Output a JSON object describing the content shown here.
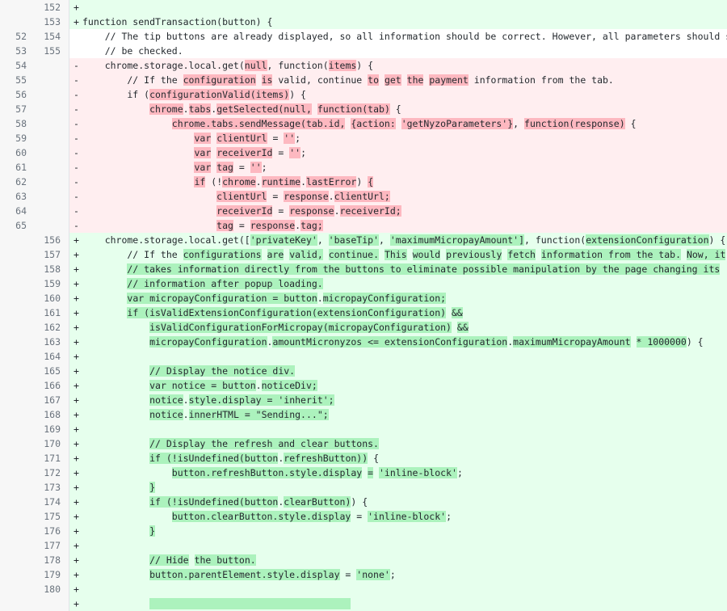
{
  "view": {
    "type": "unified-diff",
    "colors": {
      "addition_bg": "#e6ffed",
      "deletion_bg": "#ffeef0",
      "addition_word_bg": "#acf2bd",
      "deletion_word_bg": "#fdb8c0",
      "gutter_bg": "#f7f7f7",
      "gutter_border": "#e1e4e8",
      "text": "#24292e",
      "lineno_text": "#6a737d",
      "context_bg": "#ffffff"
    }
  },
  "rows": [
    {
      "old": "",
      "new": "152",
      "marker": "+",
      "type": "add",
      "segments": [
        {
          "t": "",
          "h": false
        }
      ]
    },
    {
      "old": "",
      "new": "153",
      "marker": "+",
      "type": "add",
      "segments": [
        {
          "t": "function sendTransaction(button) {",
          "h": false
        }
      ]
    },
    {
      "old": "52",
      "new": "154",
      "marker": "",
      "type": "ctx",
      "segments": [
        {
          "t": "    // The tip buttons are already displayed, so all information should be correct. However, all parameters should still",
          "h": false
        }
      ]
    },
    {
      "old": "53",
      "new": "155",
      "marker": "",
      "type": "ctx",
      "segments": [
        {
          "t": "    // be checked.",
          "h": false
        }
      ]
    },
    {
      "old": "54",
      "new": "",
      "marker": "-",
      "type": "del",
      "segments": [
        {
          "t": "    chrome.storage.local.get(",
          "h": false
        },
        {
          "t": "null",
          "h": true
        },
        {
          "t": ", function(",
          "h": false
        },
        {
          "t": "items",
          "h": true
        },
        {
          "t": ") {",
          "h": false
        }
      ]
    },
    {
      "old": "55",
      "new": "",
      "marker": "-",
      "type": "del",
      "segments": [
        {
          "t": "        // If the ",
          "h": false
        },
        {
          "t": "configuration",
          "h": true
        },
        {
          "t": " ",
          "h": false
        },
        {
          "t": "is",
          "h": true
        },
        {
          "t": " valid, continue ",
          "h": false
        },
        {
          "t": "to",
          "h": true
        },
        {
          "t": " ",
          "h": false
        },
        {
          "t": "get",
          "h": true
        },
        {
          "t": " ",
          "h": false
        },
        {
          "t": "the",
          "h": true
        },
        {
          "t": " ",
          "h": false
        },
        {
          "t": "payment",
          "h": true
        },
        {
          "t": " information from the tab.",
          "h": false
        }
      ]
    },
    {
      "old": "56",
      "new": "",
      "marker": "-",
      "type": "del",
      "segments": [
        {
          "t": "        if (",
          "h": false
        },
        {
          "t": "configurationValid(items)",
          "h": true
        },
        {
          "t": ") {",
          "h": false
        }
      ]
    },
    {
      "old": "57",
      "new": "",
      "marker": "-",
      "type": "del",
      "segments": [
        {
          "t": "            ",
          "h": false
        },
        {
          "t": "chrome",
          "h": true
        },
        {
          "t": ".",
          "h": false
        },
        {
          "t": "tabs",
          "h": true
        },
        {
          "t": ".",
          "h": false
        },
        {
          "t": "getSelected(null,",
          "h": true
        },
        {
          "t": " ",
          "h": false
        },
        {
          "t": "function(tab)",
          "h": true
        },
        {
          "t": " {",
          "h": false
        }
      ]
    },
    {
      "old": "58",
      "new": "",
      "marker": "-",
      "type": "del",
      "segments": [
        {
          "t": "                ",
          "h": false
        },
        {
          "t": "chrome.tabs.sendMessage(tab.id,",
          "h": true
        },
        {
          "t": " ",
          "h": false
        },
        {
          "t": "{action:",
          "h": true
        },
        {
          "t": " ",
          "h": false
        },
        {
          "t": "'getNyzoParameters'}",
          "h": true
        },
        {
          "t": ", ",
          "h": false
        },
        {
          "t": "function(response)",
          "h": true
        },
        {
          "t": " {",
          "h": false
        }
      ]
    },
    {
      "old": "59",
      "new": "",
      "marker": "-",
      "type": "del",
      "segments": [
        {
          "t": "                    ",
          "h": false
        },
        {
          "t": "var",
          "h": true
        },
        {
          "t": " ",
          "h": false
        },
        {
          "t": "clientUrl",
          "h": true
        },
        {
          "t": " = ",
          "h": false
        },
        {
          "t": "''",
          "h": true
        },
        {
          "t": ";",
          "h": false
        }
      ]
    },
    {
      "old": "60",
      "new": "",
      "marker": "-",
      "type": "del",
      "segments": [
        {
          "t": "                    ",
          "h": false
        },
        {
          "t": "var",
          "h": true
        },
        {
          "t": " ",
          "h": false
        },
        {
          "t": "receiverId",
          "h": true
        },
        {
          "t": " = ",
          "h": false
        },
        {
          "t": "''",
          "h": true
        },
        {
          "t": ";",
          "h": false
        }
      ]
    },
    {
      "old": "61",
      "new": "",
      "marker": "-",
      "type": "del",
      "segments": [
        {
          "t": "                    ",
          "h": false
        },
        {
          "t": "var",
          "h": true
        },
        {
          "t": " ",
          "h": false
        },
        {
          "t": "tag",
          "h": true
        },
        {
          "t": " = ",
          "h": false
        },
        {
          "t": "''",
          "h": true
        },
        {
          "t": ";",
          "h": false
        }
      ]
    },
    {
      "old": "62",
      "new": "",
      "marker": "-",
      "type": "del",
      "segments": [
        {
          "t": "                    ",
          "h": false
        },
        {
          "t": "if",
          "h": true
        },
        {
          "t": " (!",
          "h": false
        },
        {
          "t": "chrome",
          "h": true
        },
        {
          "t": ".",
          "h": false
        },
        {
          "t": "runtime",
          "h": true
        },
        {
          "t": ".",
          "h": false
        },
        {
          "t": "lastError",
          "h": true
        },
        {
          "t": ") ",
          "h": false
        },
        {
          "t": "{",
          "h": true
        }
      ]
    },
    {
      "old": "63",
      "new": "",
      "marker": "-",
      "type": "del",
      "segments": [
        {
          "t": "                        ",
          "h": false
        },
        {
          "t": "clientUrl",
          "h": true
        },
        {
          "t": " = ",
          "h": false
        },
        {
          "t": "response",
          "h": true
        },
        {
          "t": ".",
          "h": false
        },
        {
          "t": "clientUrl;",
          "h": true
        }
      ]
    },
    {
      "old": "64",
      "new": "",
      "marker": "-",
      "type": "del",
      "segments": [
        {
          "t": "                        ",
          "h": false
        },
        {
          "t": "receiverId",
          "h": true
        },
        {
          "t": " = ",
          "h": false
        },
        {
          "t": "response",
          "h": true
        },
        {
          "t": ".",
          "h": false
        },
        {
          "t": "receiverId;",
          "h": true
        }
      ]
    },
    {
      "old": "65",
      "new": "",
      "marker": "-",
      "type": "del",
      "segments": [
        {
          "t": "                        ",
          "h": false
        },
        {
          "t": "tag",
          "h": true
        },
        {
          "t": " = ",
          "h": false
        },
        {
          "t": "response",
          "h": true
        },
        {
          "t": ".",
          "h": false
        },
        {
          "t": "tag;",
          "h": true
        }
      ]
    },
    {
      "old": "",
      "new": "156",
      "marker": "+",
      "type": "add",
      "segments": [
        {
          "t": "    chrome.storage.local.get([",
          "h": false
        },
        {
          "t": "'privateKey'",
          "h": true
        },
        {
          "t": ", ",
          "h": false
        },
        {
          "t": "'baseTip'",
          "h": true
        },
        {
          "t": ", ",
          "h": false
        },
        {
          "t": "'maximumMicropayAmount']",
          "h": true
        },
        {
          "t": ", function(",
          "h": false
        },
        {
          "t": "extensionConfiguration",
          "h": true
        },
        {
          "t": ") {",
          "h": false
        }
      ]
    },
    {
      "old": "",
      "new": "157",
      "marker": "+",
      "type": "add",
      "segments": [
        {
          "t": "        // If the ",
          "h": false
        },
        {
          "t": "configurations",
          "h": true
        },
        {
          "t": " ",
          "h": false
        },
        {
          "t": "are",
          "h": true
        },
        {
          "t": " ",
          "h": false
        },
        {
          "t": "valid,",
          "h": true
        },
        {
          "t": " ",
          "h": false
        },
        {
          "t": "continue.",
          "h": true
        },
        {
          "t": " ",
          "h": false
        },
        {
          "t": "This",
          "h": true
        },
        {
          "t": " ",
          "h": false
        },
        {
          "t": "would",
          "h": true
        },
        {
          "t": " ",
          "h": false
        },
        {
          "t": "previously",
          "h": true
        },
        {
          "t": " ",
          "h": false
        },
        {
          "t": "fetch",
          "h": true
        },
        {
          "t": " ",
          "h": false
        },
        {
          "t": "information from the tab.",
          "h": true
        },
        {
          "t": " ",
          "h": false
        },
        {
          "t": "Now, it",
          "h": true
        }
      ]
    },
    {
      "old": "",
      "new": "158",
      "marker": "+",
      "type": "add",
      "segments": [
        {
          "t": "        ",
          "h": false
        },
        {
          "t": "// takes information directly from the buttons to eliminate possible manipulation by the page changing its",
          "h": true
        }
      ]
    },
    {
      "old": "",
      "new": "159",
      "marker": "+",
      "type": "add",
      "segments": [
        {
          "t": "        ",
          "h": false
        },
        {
          "t": "// information after popup loading.",
          "h": true
        }
      ]
    },
    {
      "old": "",
      "new": "160",
      "marker": "+",
      "type": "add",
      "segments": [
        {
          "t": "        ",
          "h": false
        },
        {
          "t": "var micropayConfiguration = button",
          "h": true
        },
        {
          "t": ".",
          "h": false
        },
        {
          "t": "micropayConfiguration;",
          "h": true
        }
      ]
    },
    {
      "old": "",
      "new": "161",
      "marker": "+",
      "type": "add",
      "segments": [
        {
          "t": "        ",
          "h": false
        },
        {
          "t": "if (isValidExtensionConfiguration(extensionConfiguration)",
          "h": true
        },
        {
          "t": " ",
          "h": false
        },
        {
          "t": "&&",
          "h": true
        }
      ]
    },
    {
      "old": "",
      "new": "162",
      "marker": "+",
      "type": "add",
      "segments": [
        {
          "t": "            ",
          "h": false
        },
        {
          "t": "isValidConfigurationForMicropay(micropayConfiguration)",
          "h": true
        },
        {
          "t": " ",
          "h": false
        },
        {
          "t": "&&",
          "h": true
        }
      ]
    },
    {
      "old": "",
      "new": "163",
      "marker": "+",
      "type": "add",
      "segments": [
        {
          "t": "            ",
          "h": false
        },
        {
          "t": "micropayConfiguration",
          "h": true
        },
        {
          "t": ".",
          "h": false
        },
        {
          "t": "amountMicronyzos <= extensionConfiguration",
          "h": true
        },
        {
          "t": ".",
          "h": false
        },
        {
          "t": "maximumMicropayAmount",
          "h": true
        },
        {
          "t": " ",
          "h": false
        },
        {
          "t": "* 1000000",
          "h": true
        },
        {
          "t": ") {",
          "h": false
        }
      ]
    },
    {
      "old": "",
      "new": "164",
      "marker": "+",
      "type": "add",
      "segments": [
        {
          "t": "",
          "h": false
        }
      ]
    },
    {
      "old": "",
      "new": "165",
      "marker": "+",
      "type": "add",
      "segments": [
        {
          "t": "            ",
          "h": false
        },
        {
          "t": "// Display the notice div.",
          "h": true
        }
      ]
    },
    {
      "old": "",
      "new": "166",
      "marker": "+",
      "type": "add",
      "segments": [
        {
          "t": "            ",
          "h": false
        },
        {
          "t": "var notice = button",
          "h": true
        },
        {
          "t": ".",
          "h": false
        },
        {
          "t": "noticeDiv;",
          "h": true
        }
      ]
    },
    {
      "old": "",
      "new": "167",
      "marker": "+",
      "type": "add",
      "segments": [
        {
          "t": "            ",
          "h": false
        },
        {
          "t": "notice",
          "h": true
        },
        {
          "t": ".",
          "h": false
        },
        {
          "t": "style.display = ",
          "h": true
        },
        {
          "t": "'inherit';",
          "h": true
        }
      ]
    },
    {
      "old": "",
      "new": "168",
      "marker": "+",
      "type": "add",
      "segments": [
        {
          "t": "            ",
          "h": false
        },
        {
          "t": "notice",
          "h": true
        },
        {
          "t": ".",
          "h": false
        },
        {
          "t": "innerHTML = \"Sending...\";",
          "h": true
        }
      ]
    },
    {
      "old": "",
      "new": "169",
      "marker": "+",
      "type": "add",
      "segments": [
        {
          "t": "",
          "h": false
        }
      ]
    },
    {
      "old": "",
      "new": "170",
      "marker": "+",
      "type": "add",
      "segments": [
        {
          "t": "            ",
          "h": false
        },
        {
          "t": "// Display the refresh and clear buttons.",
          "h": true
        }
      ]
    },
    {
      "old": "",
      "new": "171",
      "marker": "+",
      "type": "add",
      "segments": [
        {
          "t": "            ",
          "h": false
        },
        {
          "t": "if (!isUndefined(button",
          "h": true
        },
        {
          "t": ".",
          "h": false
        },
        {
          "t": "refreshButton))",
          "h": true
        },
        {
          "t": " {",
          "h": false
        }
      ]
    },
    {
      "old": "",
      "new": "172",
      "marker": "+",
      "type": "add",
      "segments": [
        {
          "t": "                ",
          "h": false
        },
        {
          "t": "button.refreshButton.style.display",
          "h": true
        },
        {
          "t": " ",
          "h": false
        },
        {
          "t": "=",
          "h": true
        },
        {
          "t": " ",
          "h": false
        },
        {
          "t": "'inline-block'",
          "h": true
        },
        {
          "t": ";",
          "h": false
        }
      ]
    },
    {
      "old": "",
      "new": "173",
      "marker": "+",
      "type": "add",
      "segments": [
        {
          "t": "            ",
          "h": false
        },
        {
          "t": "}",
          "h": true
        }
      ]
    },
    {
      "old": "",
      "new": "174",
      "marker": "+",
      "type": "add",
      "segments": [
        {
          "t": "            ",
          "h": false
        },
        {
          "t": "if (!isUndefined(button",
          "h": true
        },
        {
          "t": ".",
          "h": false
        },
        {
          "t": "clearButton)",
          "h": true
        },
        {
          "t": ") {",
          "h": false
        }
      ]
    },
    {
      "old": "",
      "new": "175",
      "marker": "+",
      "type": "add",
      "segments": [
        {
          "t": "                ",
          "h": false
        },
        {
          "t": "button.clearButton.style.display",
          "h": true
        },
        {
          "t": " = ",
          "h": false
        },
        {
          "t": "'inline-block'",
          "h": true
        },
        {
          "t": ";",
          "h": false
        }
      ]
    },
    {
      "old": "",
      "new": "176",
      "marker": "+",
      "type": "add",
      "segments": [
        {
          "t": "            ",
          "h": false
        },
        {
          "t": "}",
          "h": true
        }
      ]
    },
    {
      "old": "",
      "new": "177",
      "marker": "+",
      "type": "add",
      "segments": [
        {
          "t": "",
          "h": false
        }
      ]
    },
    {
      "old": "",
      "new": "178",
      "marker": "+",
      "type": "add",
      "segments": [
        {
          "t": "            ",
          "h": false
        },
        {
          "t": "// ",
          "h": true
        },
        {
          "t": "Hide",
          "h": true
        },
        {
          "t": " ",
          "h": false
        },
        {
          "t": "the button.",
          "h": true
        }
      ]
    },
    {
      "old": "",
      "new": "179",
      "marker": "+",
      "type": "add",
      "segments": [
        {
          "t": "            ",
          "h": false
        },
        {
          "t": "button.parentElement.style.display",
          "h": true
        },
        {
          "t": " = ",
          "h": false
        },
        {
          "t": "'none'",
          "h": true
        },
        {
          "t": ";",
          "h": false
        }
      ]
    },
    {
      "old": "",
      "new": "180",
      "marker": "+",
      "type": "add",
      "segments": [
        {
          "t": "",
          "h": false
        }
      ]
    },
    {
      "old": "",
      "new": "",
      "marker": "+",
      "type": "add",
      "segments": [
        {
          "t": "            ",
          "h": false
        },
        {
          "t": "                                    ",
          "h": true
        }
      ]
    }
  ]
}
